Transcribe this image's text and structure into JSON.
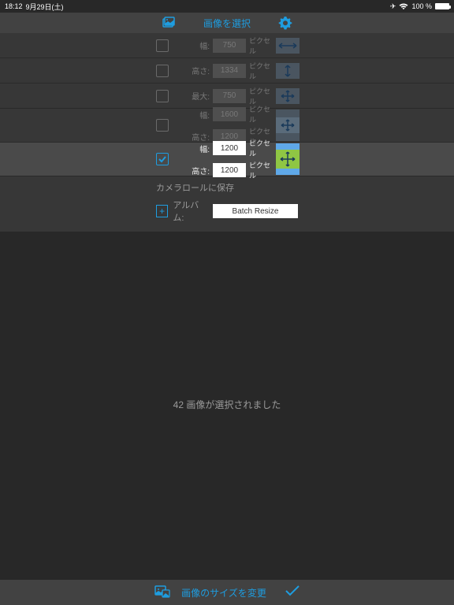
{
  "status": {
    "time": "18:12",
    "date": "9月29日(土)",
    "battery": "100 %"
  },
  "header": {
    "title": "画像を選択"
  },
  "options": [
    {
      "checked": false,
      "fields": [
        {
          "label": "幅:",
          "value": "750",
          "unit": "ピクセル"
        }
      ],
      "icon": "width"
    },
    {
      "checked": false,
      "fields": [
        {
          "label": "高さ:",
          "value": "1334",
          "unit": "ピクセル"
        }
      ],
      "icon": "height"
    },
    {
      "checked": false,
      "fields": [
        {
          "label": "最大:",
          "value": "750",
          "unit": "ピクセル"
        }
      ],
      "icon": "max"
    },
    {
      "checked": false,
      "fields": [
        {
          "label": "幅:",
          "value": "1600",
          "unit": "ピクセル"
        },
        {
          "label": "高さ:",
          "value": "1200",
          "unit": "ピクセル"
        }
      ],
      "icon": "crop"
    },
    {
      "checked": true,
      "fields": [
        {
          "label": "幅:",
          "value": "1200",
          "unit": "ピクセル"
        },
        {
          "label": "高さ:",
          "value": "1200",
          "unit": "ピクセル"
        }
      ],
      "icon": "fit"
    }
  ],
  "save": {
    "title": "カメラロールに保存",
    "albumLabel": "アルバム:",
    "albumValue": "Batch Resize"
  },
  "content": {
    "message": "42 画像が選択されました"
  },
  "footer": {
    "label": "画像のサイズを変更"
  }
}
